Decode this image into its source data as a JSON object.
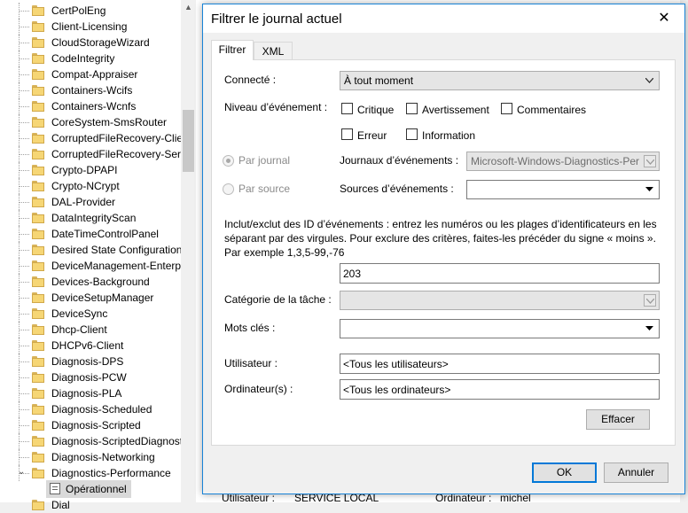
{
  "tree": {
    "items": [
      "CertPolEng",
      "Client-Licensing",
      "CloudStorageWizard",
      "CodeIntegrity",
      "Compat-Appraiser",
      "Containers-Wcifs",
      "Containers-Wcnfs",
      "CoreSystem-SmsRouter",
      "CorruptedFileRecovery-Clie",
      "CorruptedFileRecovery-Serv",
      "Crypto-DPAPI",
      "Crypto-NCrypt",
      "DAL-Provider",
      "DataIntegrityScan",
      "DateTimeControlPanel",
      "Desired State Configuration",
      "DeviceManagement-Enterp",
      "Devices-Background",
      "DeviceSetupManager",
      "DeviceSync",
      "Dhcp-Client",
      "DHCPv6-Client",
      "Diagnosis-DPS",
      "Diagnosis-PCW",
      "Diagnosis-PLA",
      "Diagnosis-Scheduled",
      "Diagnosis-Scripted",
      "Diagnosis-ScriptedDiagnost",
      "Diagnosis-Networking",
      "Diagnostics-Performance"
    ],
    "selected_child": "Opérationnel",
    "partial_next": "Dial"
  },
  "background": {
    "user_label": "Utilisateur :",
    "user_value": "SERVICE LOCAL",
    "computer_label": "Ordinateur :",
    "computer_value": "michel"
  },
  "dialog": {
    "title": "Filtrer le journal actuel",
    "tabs": [
      "Filtrer",
      "XML"
    ],
    "connected_label": "Connecté :",
    "connected_value": "À tout moment",
    "event_level_label": "Niveau d’événement :",
    "levels": [
      "Critique",
      "Avertissement",
      "Commentaires",
      "Erreur",
      "Information"
    ],
    "by_log_label": "Par journal",
    "by_source_label": "Par source",
    "event_logs_label": "Journaux d’événements :",
    "event_logs_value": "Microsoft-Windows-Diagnostics-Per",
    "event_sources_label": "Sources d’événements :",
    "event_sources_value": "",
    "help_text": "Inclut/exclut des ID d’événements : entrez les numéros ou les plages d’identificateurs en les séparant par des virgules. Pour exclure des critères, faites-les précéder du signe « moins ». Par exemple 1,3,5-99,-76",
    "event_ids_value": "203",
    "task_category_label": "Catégorie de la tâche :",
    "keywords_label": "Mots clés :",
    "user_label": "Utilisateur :",
    "user_value": "<Tous les utilisateurs>",
    "computer_label": "Ordinateur(s) :",
    "computer_value": "<Tous les ordinateurs>",
    "clear_button": "Effacer",
    "ok_button": "OK",
    "cancel_button": "Annuler"
  }
}
